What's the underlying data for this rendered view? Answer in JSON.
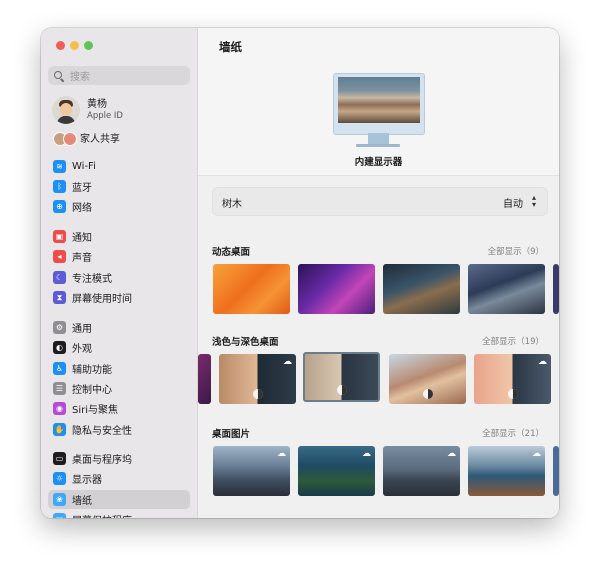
{
  "sidebar": {
    "search_placeholder": "搜索",
    "profile": {
      "name": "黄杨",
      "subtitle": "Apple ID"
    },
    "family": {
      "label": "家人共享"
    },
    "items": [
      {
        "label": "Wi-Fi",
        "icon": "wifi-icon",
        "color": "#1e8ff5",
        "glyph": "≋"
      },
      {
        "label": "蓝牙",
        "icon": "bluetooth-icon",
        "color": "#1e8ff5",
        "glyph": "ᛒ"
      },
      {
        "label": "网络",
        "icon": "globe-icon",
        "color": "#1e8ff5",
        "glyph": "⊕"
      },
      {
        "label": "通知",
        "icon": "notification-icon",
        "color": "#ee4b4b",
        "glyph": "▣"
      },
      {
        "label": "声音",
        "icon": "speaker-icon",
        "color": "#ee4b4b",
        "glyph": "◂"
      },
      {
        "label": "专注模式",
        "icon": "moon-icon",
        "color": "#5e5bd6",
        "glyph": "☾"
      },
      {
        "label": "屏幕使用时间",
        "icon": "hourglass-icon",
        "color": "#5e5bd6",
        "glyph": "⧗"
      },
      {
        "label": "通用",
        "icon": "gear-icon",
        "color": "#8e8e93",
        "glyph": "⚙"
      },
      {
        "label": "外观",
        "icon": "appearance-icon",
        "color": "#1d1d1d",
        "glyph": "◐"
      },
      {
        "label": "辅助功能",
        "icon": "accessibility-icon",
        "color": "#1e8ff5",
        "glyph": "♿"
      },
      {
        "label": "控制中心",
        "icon": "control-center-icon",
        "color": "#8e8e93",
        "glyph": "☰"
      },
      {
        "label": "Siri与聚焦",
        "icon": "siri-icon",
        "color": "#b54bd6",
        "glyph": "◉"
      },
      {
        "label": "隐私与安全性",
        "icon": "hand-icon",
        "color": "#1e8ff5",
        "glyph": "✋"
      },
      {
        "label": "桌面与程序坞",
        "icon": "dock-icon",
        "color": "#1d1d1d",
        "glyph": "▭"
      },
      {
        "label": "显示器",
        "icon": "display-icon",
        "color": "#1e8ff5",
        "glyph": "☼"
      },
      {
        "label": "墙纸",
        "icon": "wallpaper-icon",
        "color": "#3fa9f5",
        "glyph": "❀",
        "active": true
      },
      {
        "label": "屏幕保护程序",
        "icon": "screensaver-icon",
        "color": "#3fa9f5",
        "glyph": "▢"
      }
    ]
  },
  "main": {
    "title": "墙纸",
    "preview_label": "内建显示器",
    "selector": {
      "name": "树木",
      "value": "自动"
    },
    "sections": [
      {
        "title": "动态桌面",
        "show_all": "全部显示（9）"
      },
      {
        "title": "浅色与深色桌面",
        "show_all": "全部显示（19）"
      },
      {
        "title": "桌面图片",
        "show_all": "全部显示（21）"
      }
    ]
  },
  "colors": {
    "accent": "#1e8ff5",
    "sidebar_bg": "#e8e6e8",
    "active_row": "#d2d0d3"
  }
}
